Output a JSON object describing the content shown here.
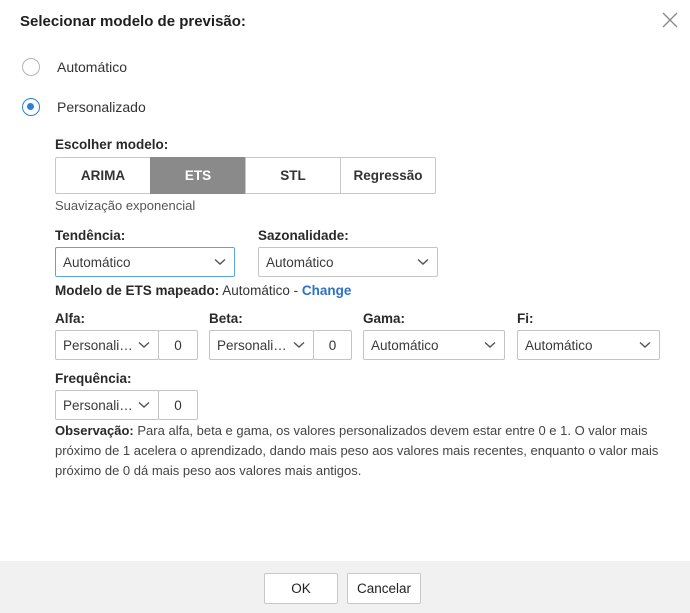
{
  "dialog": {
    "title": "Selecionar modelo de previsão:",
    "close_icon": "close-icon"
  },
  "mode": {
    "options": [
      {
        "label": "Automático",
        "selected": false
      },
      {
        "label": "Personalizado",
        "selected": true
      }
    ]
  },
  "model": {
    "label": "Escolher modelo:",
    "tabs": [
      "ARIMA",
      "ETS",
      "STL",
      "Regressão"
    ],
    "selected": "ETS",
    "description": "Suavização exponencial"
  },
  "trend": {
    "label": "Tendência:",
    "value": "Automático"
  },
  "seasonality": {
    "label": "Sazonalidade:",
    "value": "Automático"
  },
  "mapped": {
    "label": "Modelo de ETS mapeado:",
    "value": "Automático -",
    "link": "Change"
  },
  "params": {
    "alpha": {
      "label": "Alfa:",
      "select": "Personalizado",
      "value": "0"
    },
    "beta": {
      "label": "Beta:",
      "select": "Personalizado",
      "value": "0"
    },
    "gamma": {
      "label": "Gama:",
      "select": "Automático"
    },
    "phi": {
      "label": "Fi:",
      "select": "Automático"
    },
    "frequency": {
      "label": "Frequência:",
      "select": "Personalizado",
      "value": "0"
    }
  },
  "note": {
    "label": "Observação:",
    "text": "Para alfa, beta e gama, os valores personalizados devem estar entre 0 e 1. O valor mais próximo de 1 acelera o aprendizado, dando mais peso aos valores mais recentes, enquanto o valor mais próximo de 0 dá mais peso aos valores mais antigos."
  },
  "footer": {
    "ok_label": "OK",
    "cancel_label": "Cancelar"
  },
  "colors": {
    "accent": "#2f80d1",
    "link": "#2b73c5",
    "selected_tab": "#8a8a8a",
    "footer_bg": "#f1f1f1"
  }
}
